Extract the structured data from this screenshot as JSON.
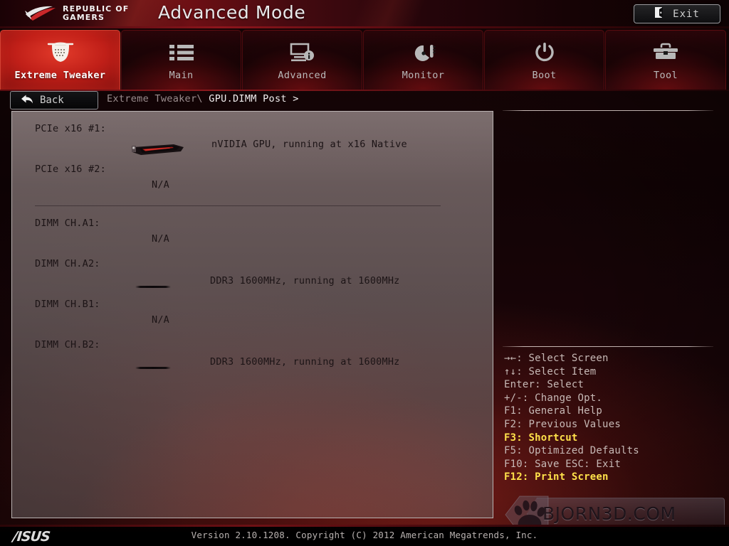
{
  "header": {
    "brand_line1": "REPUBLIC OF",
    "brand_line2": "GAMERS",
    "title": "Advanced Mode",
    "exit_label": "Exit",
    "exit_icon": "exit-door-icon"
  },
  "nav": {
    "tabs": [
      {
        "label": "Extreme Tweaker",
        "icon": "tweaker-dial-icon",
        "active": true
      },
      {
        "label": "Main",
        "icon": "list-icon",
        "active": false
      },
      {
        "label": "Advanced",
        "icon": "monitor-info-icon",
        "active": false
      },
      {
        "label": "Monitor",
        "icon": "gauge-icon",
        "active": false
      },
      {
        "label": "Boot",
        "icon": "power-icon",
        "active": false
      },
      {
        "label": "Tool",
        "icon": "toolbox-icon",
        "active": false
      }
    ]
  },
  "breadcrumb": {
    "back_label": "Back",
    "back_icon": "back-arrow-icon",
    "parent": "Extreme Tweaker\\",
    "current": "GPU.DIMM Post >"
  },
  "main": {
    "rows": [
      {
        "label": "PCIe x16 #1:",
        "value": "nVIDIA GPU, running at x16 Native",
        "graphic": "gpu-card-icon"
      },
      {
        "label": "PCIe x16 #2:",
        "value": "N/A",
        "graphic": "none"
      },
      {
        "label": "DIMM CH.A1:",
        "value": "N/A",
        "graphic": "none"
      },
      {
        "label": "DIMM CH.A2:",
        "value": "DDR3 1600MHz, running at 1600MHz",
        "graphic": "dimm-stick-icon"
      },
      {
        "label": "DIMM CH.B1:",
        "value": "N/A",
        "graphic": "none"
      },
      {
        "label": "DIMM CH.B2:",
        "value": "DDR3 1600MHz, running at 1600MHz",
        "graphic": "dimm-stick-icon"
      }
    ]
  },
  "help": {
    "items": [
      {
        "text": "→←: Select Screen",
        "highlight": false
      },
      {
        "text": "↑↓: Select Item",
        "highlight": false
      },
      {
        "text": "Enter: Select",
        "highlight": false
      },
      {
        "text": "+/-: Change Opt.",
        "highlight": false
      },
      {
        "text": "F1: General Help",
        "highlight": false
      },
      {
        "text": "F2: Previous Values",
        "highlight": false
      },
      {
        "text": "F3: Shortcut",
        "highlight": true
      },
      {
        "text": "F5: Optimized Defaults",
        "highlight": false
      },
      {
        "text": "F10: Save  ESC: Exit",
        "highlight": false
      },
      {
        "text": "F12: Print Screen",
        "highlight": true
      }
    ]
  },
  "footer": {
    "brand": "/ISUS",
    "version": "Version 2.10.1208. Copyright (C) 2012 American Megatrends, Inc."
  },
  "watermark": {
    "text": "BJORN3D.COM",
    "icon": "bear-paw-icon"
  },
  "colors": {
    "accent_red": "#c01f18",
    "highlight_yellow": "#ffe14a",
    "panel_gray": "#8c7e7e",
    "header_red": "#6e0f14"
  }
}
